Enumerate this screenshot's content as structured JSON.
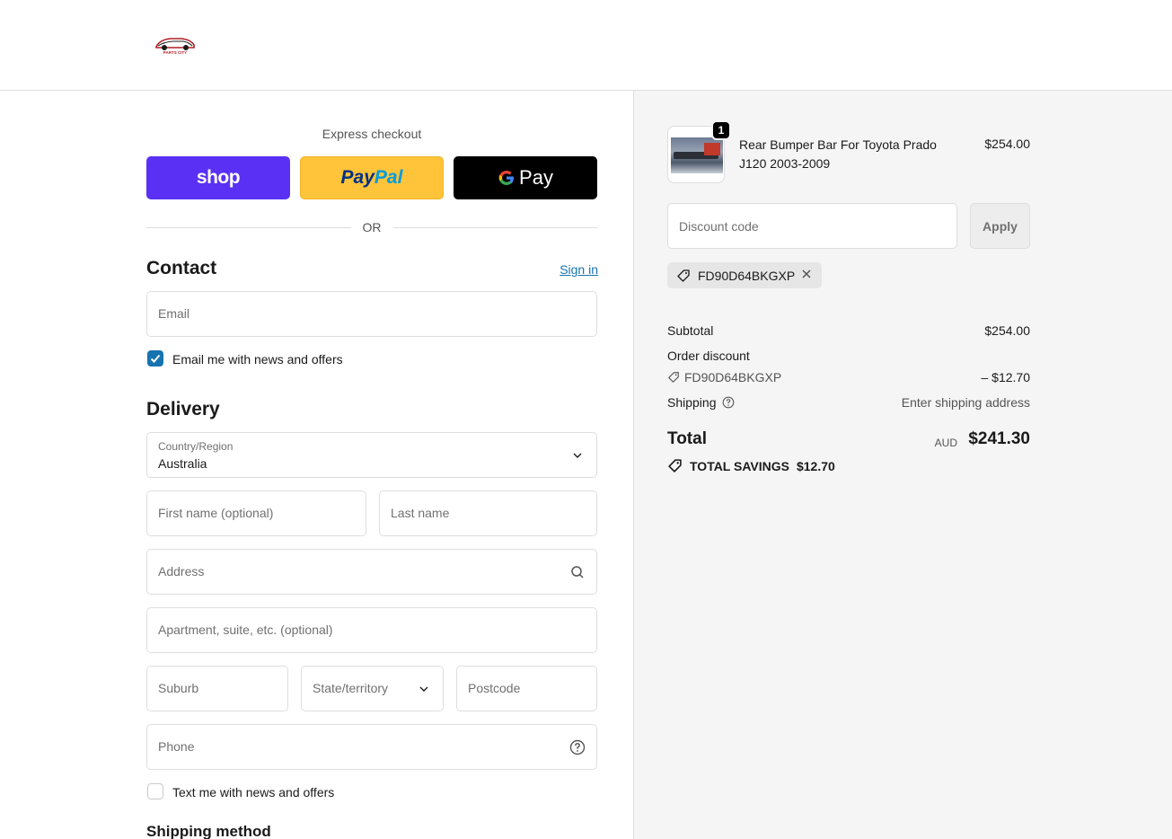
{
  "brand": {
    "logo_alt": "PARTS CITY"
  },
  "express": {
    "title": "Express checkout",
    "shop_label": "shop",
    "paypal_part1": "Pay",
    "paypal_part2": "Pal",
    "gpay_g": "G",
    "gpay_label": "Pay",
    "or_label": "OR"
  },
  "contact": {
    "title": "Contact",
    "sign_in": "Sign in",
    "email_placeholder": "Email",
    "news_checkbox_label": "Email me with news and offers",
    "news_checked": true
  },
  "delivery": {
    "title": "Delivery",
    "country_label": "Country/Region",
    "country_value": "Australia",
    "first_name_placeholder": "First name (optional)",
    "last_name_placeholder": "Last name",
    "address_placeholder": "Address",
    "apartment_placeholder": "Apartment, suite, etc. (optional)",
    "suburb_placeholder": "Suburb",
    "state_placeholder": "State/territory",
    "postcode_placeholder": "Postcode",
    "phone_placeholder": "Phone",
    "text_checkbox_label": "Text me with news and offers",
    "text_checked": false
  },
  "shipping_method": {
    "title": "Shipping method"
  },
  "summary": {
    "product": {
      "quantity": "1",
      "name": "Rear Bumper Bar For Toyota Prado J120 2003-2009",
      "price": "$254.00"
    },
    "discount_placeholder": "Discount code",
    "apply_label": "Apply",
    "applied_code": "FD90D64BKGXP",
    "subtotal_label": "Subtotal",
    "subtotal_value": "$254.00",
    "order_discount_label": "Order discount",
    "order_discount_code": "FD90D64BKGXP",
    "order_discount_value": "– $12.70",
    "shipping_label": "Shipping",
    "shipping_value": "Enter shipping address",
    "total_label": "Total",
    "total_currency": "AUD",
    "total_value": "$241.30",
    "savings_label": "TOTAL SAVINGS",
    "savings_value": "$12.70"
  },
  "colors": {
    "shop_purple": "#5a31f4",
    "paypal_yellow": "#ffc439",
    "link_blue": "#1773b0",
    "summary_bg": "#f5f5f5"
  }
}
